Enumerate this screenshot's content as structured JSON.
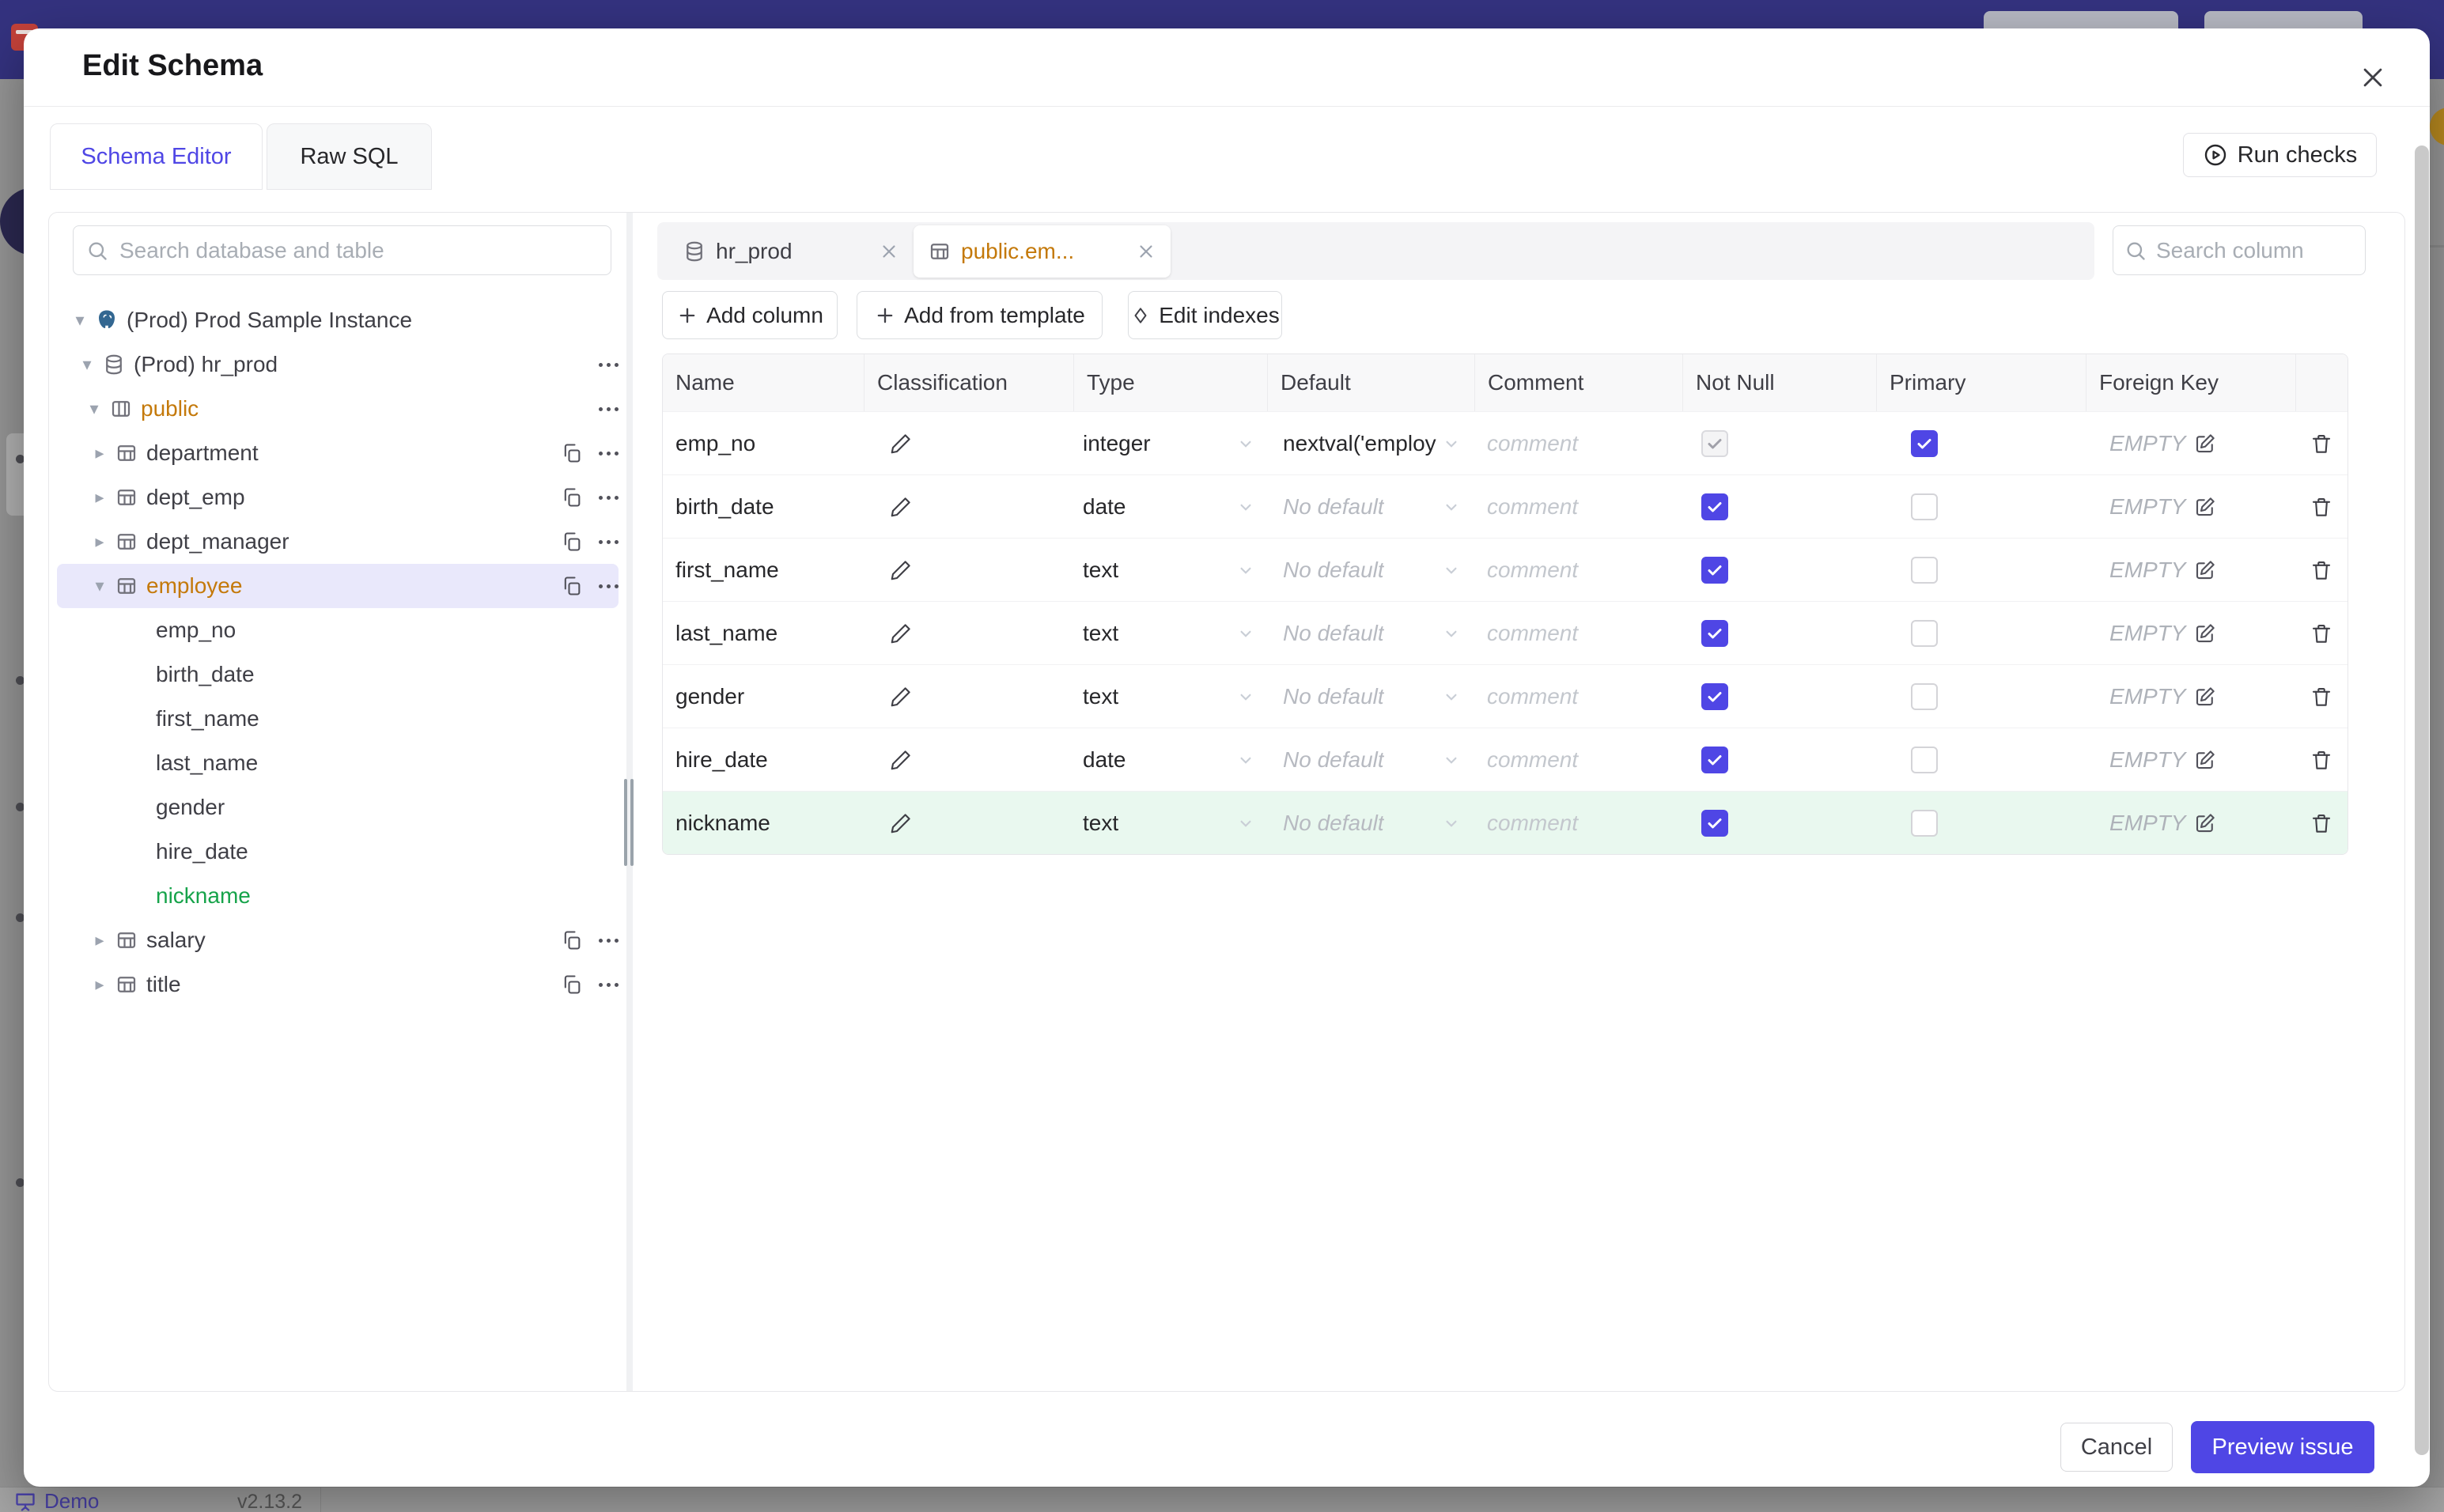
{
  "modal": {
    "title": "Edit Schema",
    "tabs": [
      {
        "label": "Schema Editor",
        "active": true
      },
      {
        "label": "Raw SQL",
        "active": false
      }
    ],
    "run_checks_label": "Run checks",
    "footer": {
      "cancel_label": "Cancel",
      "preview_label": "Preview issue"
    }
  },
  "sidebar": {
    "search_placeholder": "Search database and table",
    "tree": [
      {
        "label": "(Prod) Prod Sample Instance",
        "level": 1,
        "caret": "down",
        "icon": "postgres"
      },
      {
        "label": "(Prod) hr_prod",
        "level": 2,
        "caret": "down",
        "icon": "database",
        "dots": true
      },
      {
        "label": "public",
        "level": 3,
        "caret": "down",
        "icon": "schema",
        "color": "amber",
        "dots": true
      },
      {
        "label": "department",
        "level": 4,
        "caret": "right",
        "icon": "table",
        "copy": true,
        "dots": true
      },
      {
        "label": "dept_emp",
        "level": 4,
        "caret": "right",
        "icon": "table",
        "copy": true,
        "dots": true
      },
      {
        "label": "dept_manager",
        "level": 4,
        "caret": "right",
        "icon": "table",
        "copy": true,
        "dots": true
      },
      {
        "label": "employee",
        "level": 4,
        "caret": "down",
        "icon": "table",
        "color": "amber",
        "selected": true,
        "copy": true,
        "dots": true
      },
      {
        "label": "emp_no",
        "level": 5
      },
      {
        "label": "birth_date",
        "level": 5
      },
      {
        "label": "first_name",
        "level": 5
      },
      {
        "label": "last_name",
        "level": 5
      },
      {
        "label": "gender",
        "level": 5
      },
      {
        "label": "hire_date",
        "level": 5
      },
      {
        "label": "nickname",
        "level": 5,
        "color": "green"
      },
      {
        "label": "salary",
        "level": 4,
        "caret": "right",
        "icon": "table",
        "copy": true,
        "dots": true
      },
      {
        "label": "title",
        "level": 4,
        "caret": "right",
        "icon": "table",
        "copy": true,
        "dots": true
      }
    ]
  },
  "editor": {
    "chips": [
      {
        "label": "hr_prod",
        "icon": "database"
      },
      {
        "label": "public.em...",
        "icon": "table",
        "active": true
      }
    ],
    "column_search_placeholder": "Search column",
    "actions": {
      "add_column": "Add column",
      "add_from_template": "Add from template",
      "edit_indexes": "Edit indexes"
    },
    "table": {
      "headers": [
        "Name",
        "Classification",
        "Type",
        "Default",
        "Comment",
        "Not Null",
        "Primary",
        "Foreign Key"
      ],
      "comment_placeholder": "comment",
      "foreign_key_empty": "EMPTY",
      "rows": [
        {
          "name": "emp_no",
          "type": "integer",
          "default": "nextval('employ",
          "default_set": true,
          "not_null": "checked-disabled",
          "primary": true,
          "highlight": false
        },
        {
          "name": "birth_date",
          "type": "date",
          "default": "No default",
          "default_set": false,
          "not_null": "checked",
          "primary": false,
          "highlight": false
        },
        {
          "name": "first_name",
          "type": "text",
          "default": "No default",
          "default_set": false,
          "not_null": "checked",
          "primary": false,
          "highlight": false
        },
        {
          "name": "last_name",
          "type": "text",
          "default": "No default",
          "default_set": false,
          "not_null": "checked",
          "primary": false,
          "highlight": false
        },
        {
          "name": "gender",
          "type": "text",
          "default": "No default",
          "default_set": false,
          "not_null": "checked",
          "primary": false,
          "highlight": false
        },
        {
          "name": "hire_date",
          "type": "date",
          "default": "No default",
          "default_set": false,
          "not_null": "checked",
          "primary": false,
          "highlight": false
        },
        {
          "name": "nickname",
          "type": "text",
          "default": "No default",
          "default_set": false,
          "not_null": "checked",
          "primary": false,
          "highlight": true
        }
      ]
    }
  },
  "background": {
    "demo_label": "Demo",
    "version": "v2.13.2"
  },
  "colors": {
    "accent": "#4f46e5",
    "amber": "#c4790a",
    "green": "#16a34a",
    "highlight_row": "#e9f8ef",
    "selected_tree_row": "#e9e8fb",
    "header_purple": "#34327f"
  }
}
